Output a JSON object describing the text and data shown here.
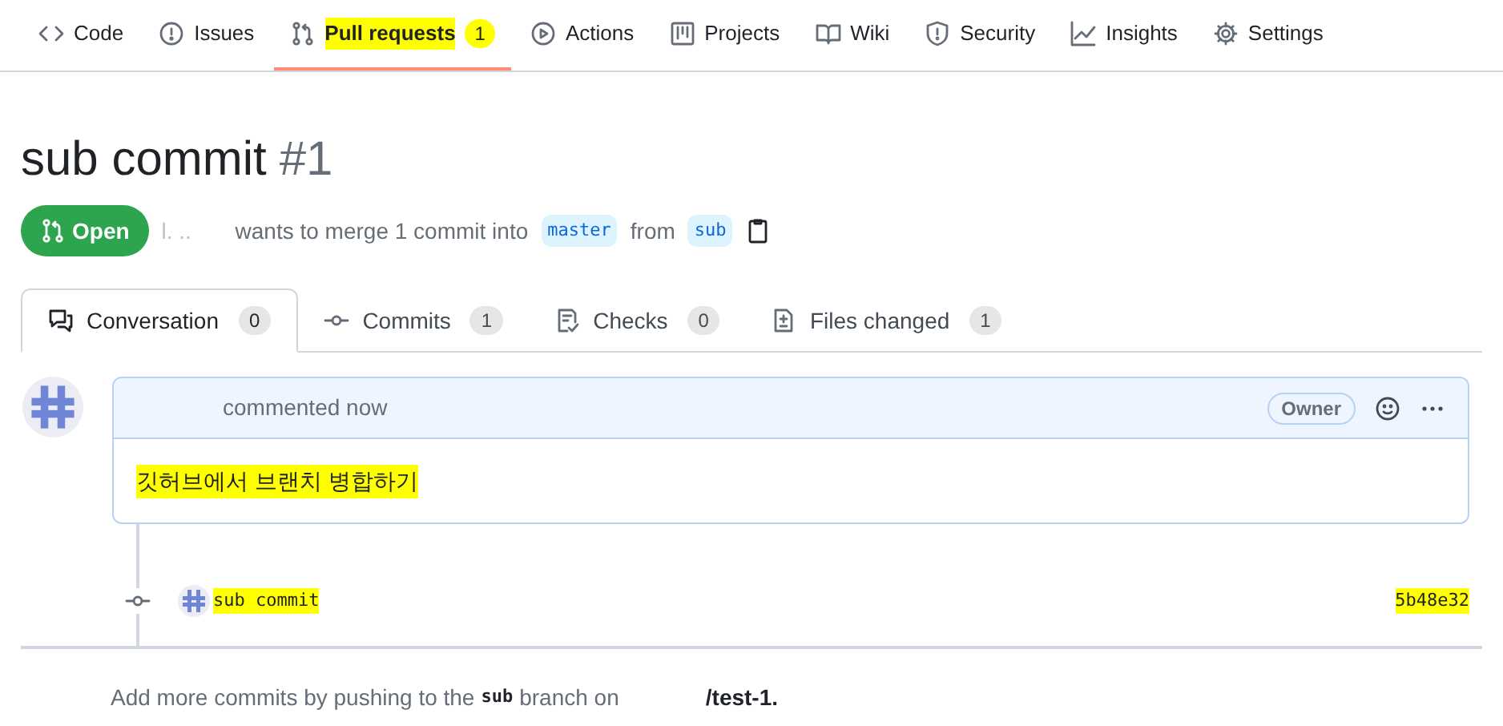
{
  "repo_nav": [
    {
      "label": "Code",
      "selected": false
    },
    {
      "label": "Issues",
      "selected": false
    },
    {
      "label": "Pull requests",
      "count": "1",
      "selected": true,
      "highlighted": true
    },
    {
      "label": "Actions",
      "selected": false
    },
    {
      "label": "Projects",
      "selected": false
    },
    {
      "label": "Wiki",
      "selected": false
    },
    {
      "label": "Security",
      "selected": false
    },
    {
      "label": "Insights",
      "selected": false
    },
    {
      "label": "Settings",
      "selected": false
    }
  ],
  "title": "sub commit",
  "number": "#1",
  "state": {
    "label": "Open",
    "author": "l. ..",
    "summary": "wants to merge 1 commit into",
    "base": "master",
    "from": "from",
    "head": "sub"
  },
  "pr_tabs": [
    {
      "label": "Conversation",
      "count": "0",
      "selected": true
    },
    {
      "label": "Commits",
      "count": "1",
      "selected": false
    },
    {
      "label": "Checks",
      "count": "0",
      "selected": false
    },
    {
      "label": "Files changed",
      "count": "1",
      "selected": false
    }
  ],
  "comment": {
    "header": "commented now",
    "role": "Owner",
    "body": "깃허브에서 브랜치 병합하기",
    "highlighted": true
  },
  "commits": [
    {
      "message": "sub commit",
      "sha": "5b48e32",
      "highlighted": true
    }
  ],
  "footer": {
    "text": "Add more commits by pushing to the",
    "branch": "sub",
    "rest": "branch on",
    "repo": "/test-1."
  }
}
